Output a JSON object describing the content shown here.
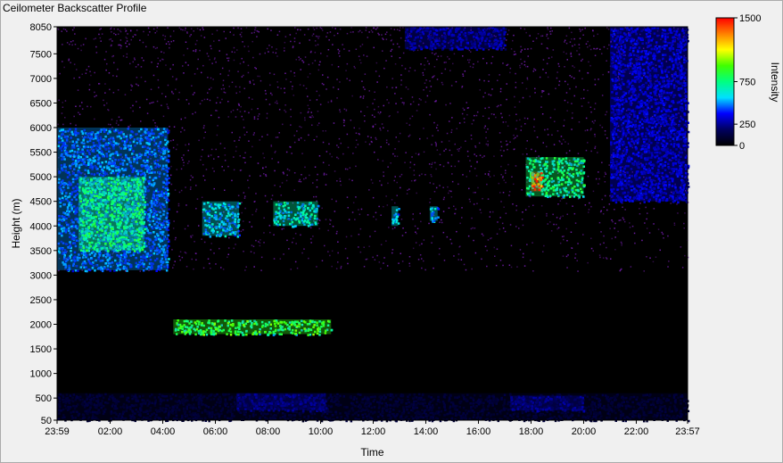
{
  "window": {
    "title": "Ceilometer Backscatter Profile"
  },
  "chart_data": {
    "type": "heatmap",
    "title": "Ceilometer Backscatter Profile",
    "xlabel": "Time",
    "ylabel": "Height (m)",
    "x_tick_labels": [
      "23:59",
      "02:00",
      "04:00",
      "06:00",
      "08:00",
      "10:00",
      "12:00",
      "14:00",
      "16:00",
      "18:00",
      "20:00",
      "22:00",
      "23:57"
    ],
    "x_tick_hours": [
      -0.0167,
      2,
      4,
      6,
      8,
      10,
      12,
      14,
      16,
      18,
      20,
      22,
      23.95
    ],
    "xlim_hours": [
      -0.0167,
      23.95
    ],
    "y_ticks": [
      50,
      500,
      1000,
      1500,
      2000,
      2500,
      3000,
      3500,
      4000,
      4500,
      5000,
      5500,
      6000,
      6500,
      7000,
      7500,
      8050
    ],
    "ylim": [
      50,
      8050
    ],
    "colorbar": {
      "label": "Intensity",
      "ticks": [
        0,
        250,
        750,
        1500
      ],
      "range": [
        0,
        1500
      ],
      "colors": [
        "#000000",
        "#000060",
        "#0000ff",
        "#00e0ff",
        "#00ff80",
        "#40ff00",
        "#ffff00",
        "#ff8000",
        "#ff0000"
      ]
    },
    "background_color": "#000000",
    "noise_color": "#8020c0",
    "features": [
      {
        "name": "surface layer",
        "t0": 0,
        "t1": 23.95,
        "h0": 50,
        "h1": 600,
        "intensity": 120
      },
      {
        "name": "enhanced surface layer",
        "t0": 6.8,
        "t1": 10.2,
        "h0": 250,
        "h1": 600,
        "intensity": 250
      },
      {
        "name": "enhanced surface layer",
        "t0": 17.2,
        "t1": 20.0,
        "h0": 250,
        "h1": 550,
        "intensity": 250
      },
      {
        "name": "high cloud",
        "t0": 0,
        "t1": 4.2,
        "h0": 3100,
        "h1": 6000,
        "intensity": 500
      },
      {
        "name": "high cloud core",
        "t0": 0.8,
        "t1": 3.3,
        "h0": 3500,
        "h1": 5000,
        "intensity": 800
      },
      {
        "name": "mid cloud",
        "t0": 5.5,
        "t1": 6.9,
        "h0": 3800,
        "h1": 4500,
        "intensity": 600
      },
      {
        "name": "mid cloud",
        "t0": 8.2,
        "t1": 9.9,
        "h0": 4000,
        "h1": 4500,
        "intensity": 700
      },
      {
        "name": "low cloud",
        "t0": 4.4,
        "t1": 10.4,
        "h0": 1800,
        "h1": 2100,
        "intensity": 900
      },
      {
        "name": "cloud",
        "t0": 12.7,
        "t1": 12.95,
        "h0": 4000,
        "h1": 4400,
        "intensity": 600
      },
      {
        "name": "cloud",
        "t0": 14.15,
        "t1": 14.45,
        "h0": 4100,
        "h1": 4400,
        "intensity": 600
      },
      {
        "name": "high cloud",
        "t0": 17.8,
        "t1": 20.0,
        "h0": 4600,
        "h1": 5400,
        "intensity": 800
      },
      {
        "name": "high cloud core",
        "t0": 18.0,
        "t1": 18.4,
        "h0": 4700,
        "h1": 5100,
        "intensity": 1400
      },
      {
        "name": "high cloud streaks",
        "t0": 21.0,
        "t1": 23.95,
        "h0": 4500,
        "h1": 8050,
        "intensity": 350
      },
      {
        "name": "top streaks",
        "t0": 13.2,
        "t1": 17.0,
        "h0": 7600,
        "h1": 8050,
        "intensity": 300
      }
    ]
  }
}
